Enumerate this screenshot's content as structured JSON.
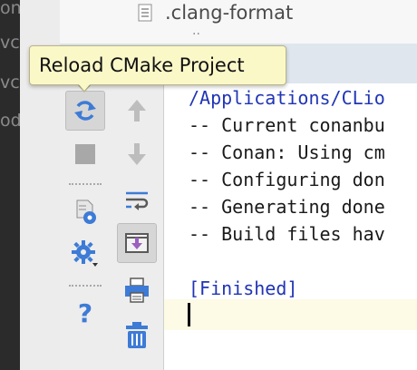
{
  "left_strip": {
    "fragments": [
      "on.",
      "vc",
      "vc",
      "od"
    ]
  },
  "tree": {
    "file_name": ".clang-format",
    "file_below": "··"
  },
  "tooltip": {
    "text": "Reload CMake Project"
  },
  "toolbar": {
    "icons": [
      "reload-cmake-icon",
      "stop-icon",
      "cmake-settings-icon",
      "gear-icon",
      "help-icon",
      "up-arrow-icon",
      "down-arrow-icon",
      "soft-wrap-icon",
      "scroll-to-end-icon",
      "print-icon",
      "trash-icon"
    ],
    "accent": "#3d7bd6"
  },
  "console": {
    "lines": [
      "/Applications/CLio",
      "-- Current conanbu",
      "-- Conan: Using cm",
      "-- Configuring don",
      "-- Generating done",
      "-- Build files hav"
    ],
    "finished": "[Finished]"
  }
}
